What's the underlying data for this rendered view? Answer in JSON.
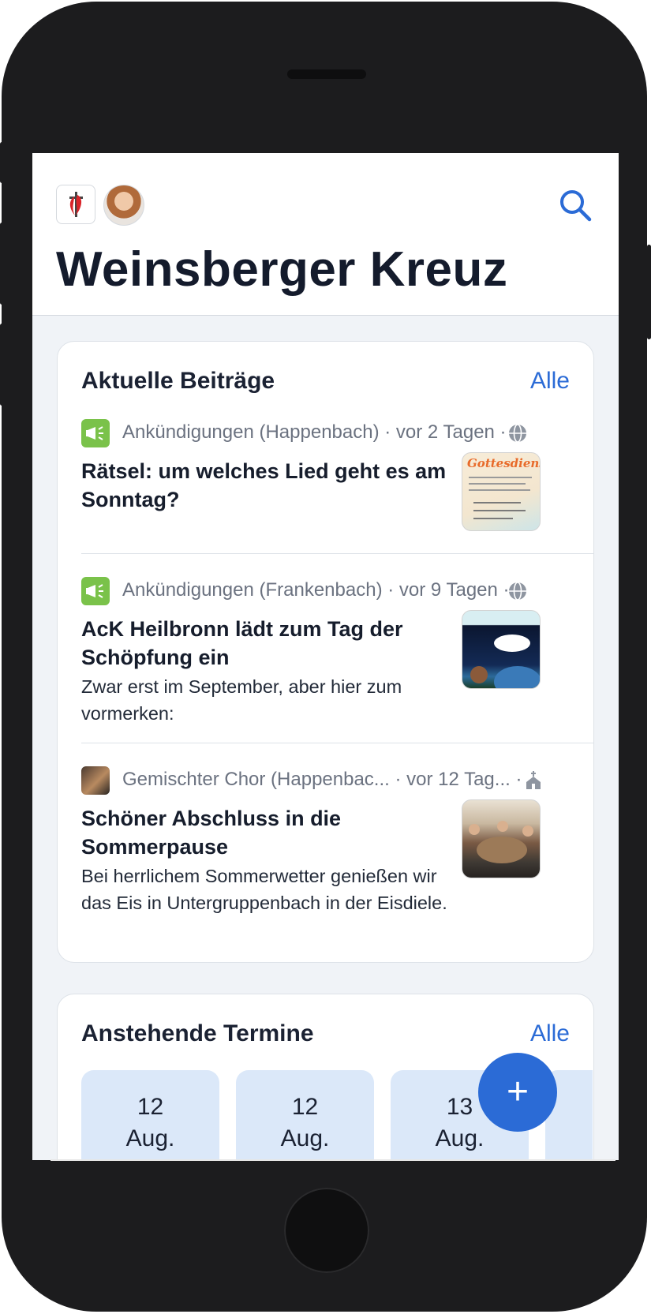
{
  "header": {
    "title": "Weinsberger Kreuz",
    "church_logo_icon": "cross-flame-logo-icon",
    "avatar_icon": "user-avatar",
    "search_icon": "search-icon"
  },
  "posts_section": {
    "title": "Aktuelle Beiträge",
    "link": "Alle",
    "posts": [
      {
        "category": "Ankündigungen (Happenbach) · vor 2 Tagen ·",
        "category_icon": "megaphone-icon",
        "visibility_icon": "globe-icon",
        "title": "Rätsel: um welches Lied geht es am Sonntag?",
        "body": "",
        "thumb_text": "Gottesdienste"
      },
      {
        "category": "Ankündigungen (Frankenbach) · vor 9 Tagen ·",
        "category_icon": "megaphone-icon",
        "visibility_icon": "globe-icon",
        "title": "AcK Heilbronn lädt zum Tag der Schöpfung ein",
        "body": "Zwar erst im September, aber hier zum vormerken:",
        "thumb_text": ""
      },
      {
        "category": "Gemischter Chor (Happenbac... · vor 12 Tag... ·",
        "category_icon": "group-photo",
        "visibility_icon": "church-icon",
        "title": "Schöner Abschluss in die Sommerpause",
        "body": "Bei herrlichem Sommerwetter genießen wir das Eis in Untergruppenbach in der Eisdiele.",
        "thumb_text": ""
      }
    ]
  },
  "events_section": {
    "title": "Anstehende Termine",
    "link": "Alle",
    "dates": [
      {
        "day": "12",
        "month": "Aug."
      },
      {
        "day": "12",
        "month": "Aug."
      },
      {
        "day": "13",
        "month": "Aug."
      }
    ]
  },
  "fab": {
    "label": "+",
    "icon": "plus-icon"
  },
  "colors": {
    "accent": "#2b6bd6",
    "category_green": "#7ac24a",
    "date_tile": "#dbe8f9"
  }
}
